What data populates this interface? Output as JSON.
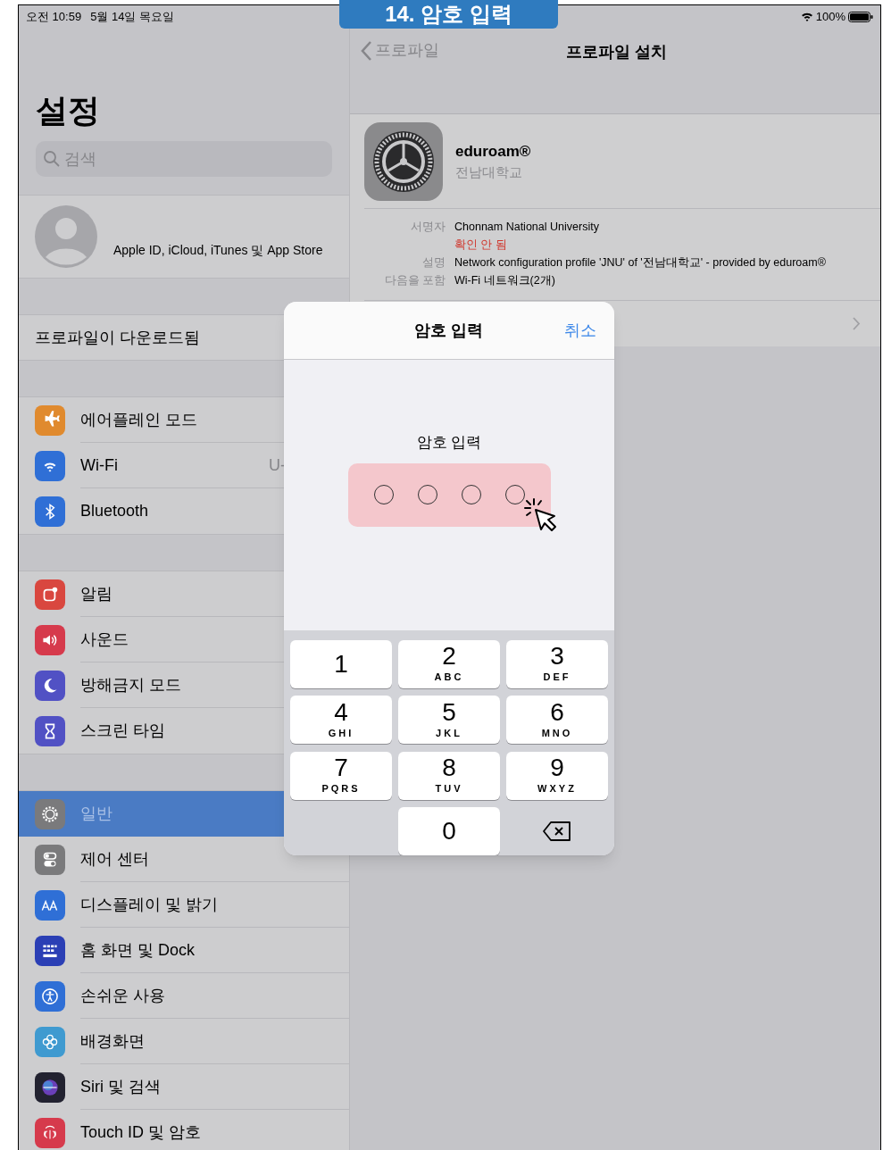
{
  "caption": {
    "text": "14. 암호 입력"
  },
  "status_bar": {
    "time": "오전 10:59",
    "date": "5월 14일 목요일",
    "battery": "100%"
  },
  "sidebar": {
    "title": "설정",
    "search": {
      "placeholder": "검색"
    },
    "account": {
      "label": "Apple ID, iCloud, iTunes 및 App Store"
    },
    "notice": {
      "label": "프로파일이 다운로드됨"
    },
    "groups": [
      [
        {
          "label": "에어플레인 모드",
          "selected": false
        },
        {
          "label": "Wi-Fi",
          "value": "U-",
          "selected": false
        },
        {
          "label": "Bluetooth",
          "selected": false
        }
      ],
      [
        {
          "label": "알림",
          "selected": false
        },
        {
          "label": "사운드",
          "selected": false
        },
        {
          "label": "방해금지 모드",
          "selected": false
        },
        {
          "label": "스크린 타임",
          "selected": false
        }
      ],
      [
        {
          "label": "일반",
          "selected": true
        },
        {
          "label": "제어 센터",
          "selected": false
        },
        {
          "label": "디스플레이 및 밝기",
          "selected": false
        },
        {
          "label": "홈 화면 및 Dock",
          "selected": false
        },
        {
          "label": "손쉬운 사용",
          "selected": false
        },
        {
          "label": "배경화면",
          "selected": false
        },
        {
          "label": "Siri 및 검색",
          "selected": false
        },
        {
          "label": "Touch ID 및 암호",
          "selected": false
        }
      ]
    ]
  },
  "detail": {
    "back": "프로파일",
    "title": "프로파일 설치",
    "profile": {
      "name": "eduroam®",
      "org": "전남대학교"
    },
    "fields": [
      {
        "label": "서명자",
        "value": "Chonnam National University",
        "status": "확인 안 됨"
      },
      {
        "label": "설명",
        "value": "Network configuration profile 'JNU' of '전남대학교' - provided by eduroam®"
      },
      {
        "label": "다음을 포함",
        "value": "Wi-Fi 네트워크(2개)"
      }
    ]
  },
  "dialog": {
    "title": "암호 입력",
    "cancel": "취소",
    "prompt": "암호 입력",
    "dots": [
      {
        "filled": false
      },
      {
        "filled": false
      },
      {
        "filled": false
      },
      {
        "filled": false
      }
    ],
    "keys": [
      {
        "kind": "digit",
        "digit": "1"
      },
      {
        "kind": "digit",
        "digit": "2",
        "letters": "ABC"
      },
      {
        "kind": "digit",
        "digit": "3",
        "letters": "DEF"
      },
      {
        "kind": "digit",
        "digit": "4",
        "letters": "GHI"
      },
      {
        "kind": "digit",
        "digit": "5",
        "letters": "JKL"
      },
      {
        "kind": "digit",
        "digit": "6",
        "letters": "MNO"
      },
      {
        "kind": "digit",
        "digit": "7",
        "letters": "PQRS"
      },
      {
        "kind": "digit",
        "digit": "8",
        "letters": "TUV"
      },
      {
        "kind": "digit",
        "digit": "9",
        "letters": "WXYZ"
      },
      {
        "kind": "blank"
      },
      {
        "kind": "digit",
        "digit": "0"
      },
      {
        "kind": "delete"
      }
    ]
  }
}
